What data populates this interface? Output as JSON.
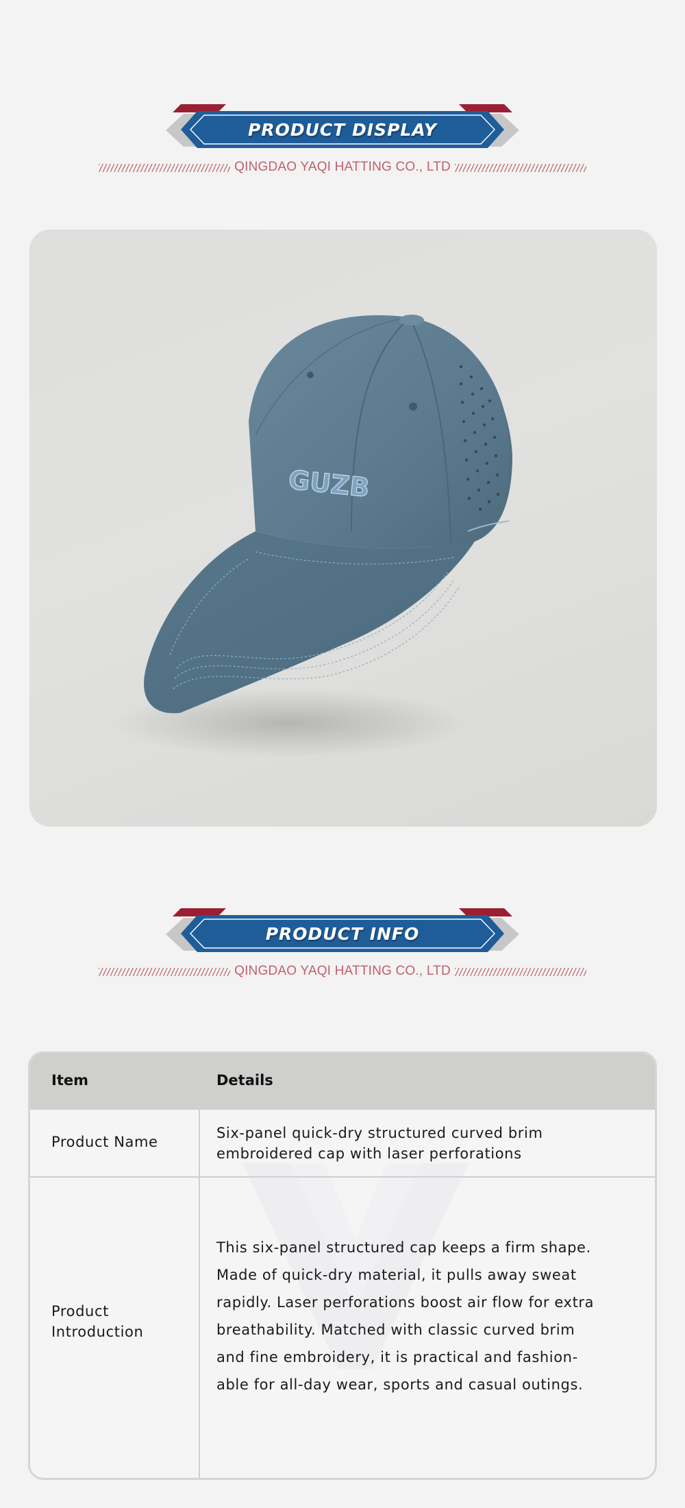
{
  "sections": {
    "display": {
      "title": "PRODUCT DISPLAY",
      "company": "QINGDAO YAQI HATTING CO., LTD"
    },
    "info": {
      "title": "PRODUCT INFO",
      "company": "QINGDAO YAQI HATTING CO., LTD"
    }
  },
  "product_image": {
    "embroidery_text": "GUZB",
    "cap_color": "#5f7d91"
  },
  "table": {
    "headers": [
      "Item",
      "Details"
    ],
    "rows": [
      {
        "item": "Product Name",
        "details_lines": [
          "Six-panel quick-dry structured curved brim",
          "embroidered cap with laser perforations"
        ]
      },
      {
        "item_lines": [
          "Product",
          "Introduction"
        ],
        "details_lines": [
          "This six-panel structured cap keeps a firm shape.",
          "Made of quick-dry material, it pulls away sweat",
          "rapidly. Laser perforations boost air flow for extra",
          "breathability. Matched with classic curved brim",
          "and fine embroidery, it is practical and fashion-",
          "able for all-day wear, sports and casual outings."
        ]
      }
    ]
  },
  "colors": {
    "banner_blue": "#1f5d99",
    "banner_red": "#9b1f33",
    "company_text": "#c0606c",
    "table_header_bg": "#cfcfcd"
  }
}
